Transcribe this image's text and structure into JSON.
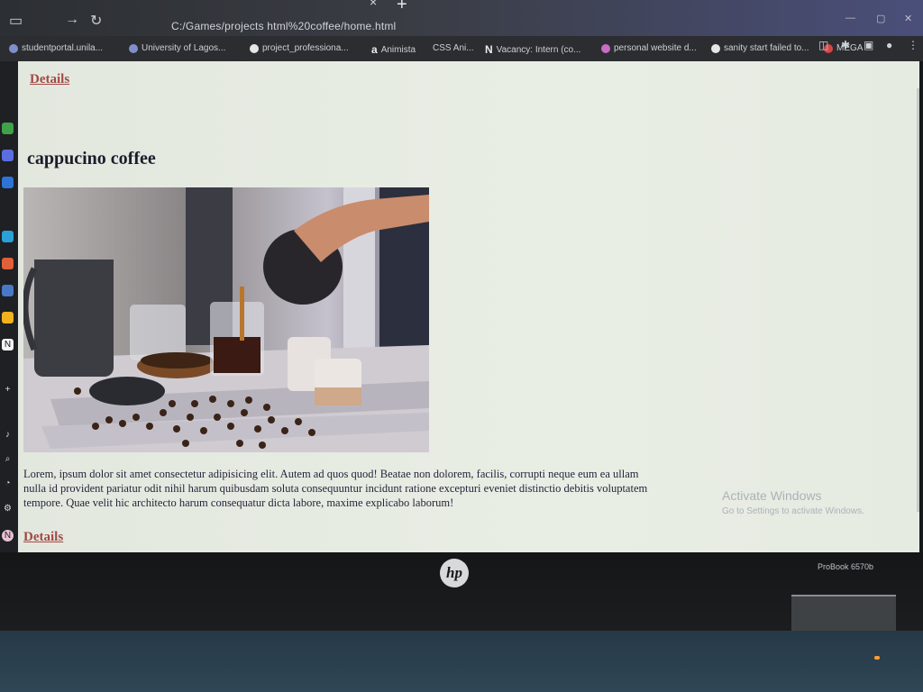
{
  "browser": {
    "address": "C:/Games/projects html%20coffee/home.html",
    "new_tab": "+",
    "close_tab": "×",
    "bookmarks": [
      {
        "label": "studentportal.unila...",
        "icon": "globe-icon"
      },
      {
        "label": "University of Lagos...",
        "icon": "globe-icon"
      },
      {
        "label": "project_professiona...",
        "icon": "github-icon"
      },
      {
        "label": "Animista",
        "icon": "a-icon"
      },
      {
        "label": "CSS Ani...",
        "icon": "css-icon"
      },
      {
        "label": "Vacancy: Intern (co...",
        "icon": "notion-icon"
      },
      {
        "label": "personal website d...",
        "icon": "figma-icon"
      },
      {
        "label": "sanity start failed to...",
        "icon": "github-icon"
      },
      {
        "label": "MEGA",
        "icon": "mega-icon"
      }
    ]
  },
  "page": {
    "top_link": "Details",
    "heading": "cappucino coffee",
    "paragraph": "Lorem, ipsum dolor sit amet consectetur adipisicing elit. Autem ad quos quod! Beatae non dolorem, facilis, corrupti neque eum ea ullam nulla id provident pariatur odit nihil harum quibusdam soluta consequuntur incidunt ratione excepturi eveniet distinctio debitis voluptatem tempore. Quae velit hic architecto harum consequatur dicta labore, maxime explicabo laborum!",
    "bottom_link": "Details"
  },
  "watermark": {
    "line1": "Activate Windows",
    "line2": "Go to Settings to activate Windows."
  },
  "laptop": {
    "brand": "hp",
    "model": "ProBook 6570b"
  },
  "colors": {
    "page_bg": "#e6ebe2",
    "link": "#a14a45",
    "text": "#1b1d2b"
  }
}
